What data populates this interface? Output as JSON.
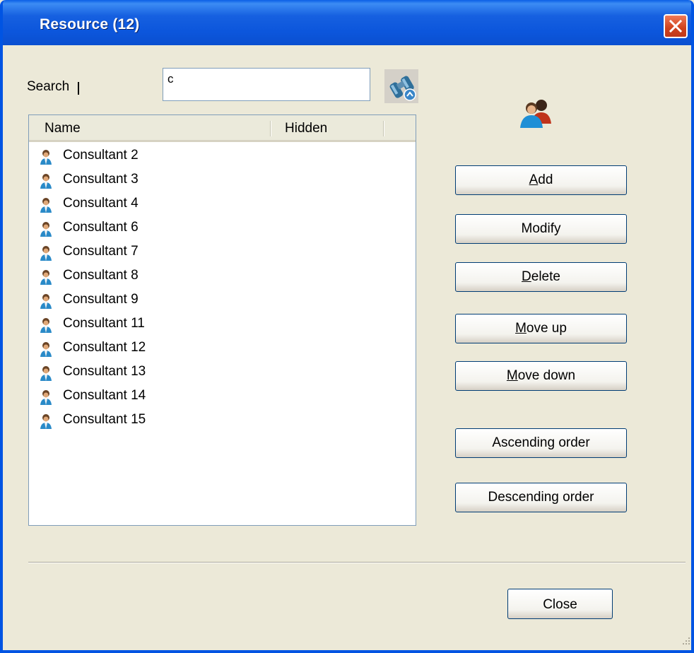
{
  "window": {
    "title": "Resource (12)"
  },
  "search": {
    "label": "Search",
    "value": "c"
  },
  "list": {
    "columns": [
      "Name",
      "Hidden"
    ],
    "rows": [
      {
        "name": "Consultant 2",
        "hidden": ""
      },
      {
        "name": "Consultant 3",
        "hidden": ""
      },
      {
        "name": "Consultant 4",
        "hidden": ""
      },
      {
        "name": "Consultant 6",
        "hidden": ""
      },
      {
        "name": "Consultant 7",
        "hidden": ""
      },
      {
        "name": "Consultant 8",
        "hidden": ""
      },
      {
        "name": "Consultant 9",
        "hidden": ""
      },
      {
        "name": "Consultant 11",
        "hidden": ""
      },
      {
        "name": "Consultant 12",
        "hidden": ""
      },
      {
        "name": "Consultant 13",
        "hidden": ""
      },
      {
        "name": "Consultant 14",
        "hidden": ""
      },
      {
        "name": "Consultant 15",
        "hidden": ""
      }
    ]
  },
  "buttons": {
    "add": {
      "label": "Add",
      "mnemonic": "A"
    },
    "modify": {
      "label": "Modify"
    },
    "delete": {
      "label": "Delete",
      "mnemonic": "D"
    },
    "move_up": {
      "label": "Move up",
      "mnemonic": "M"
    },
    "move_down": {
      "label": "Move down",
      "mnemonic": "M"
    },
    "ascending": {
      "label": "Ascending order"
    },
    "descending": {
      "label": "Descending order"
    },
    "close": {
      "label": "Close"
    }
  },
  "icons": {
    "close": "close-icon",
    "find": "binoculars-icon",
    "users": "users-icon",
    "row": "person-icon"
  },
  "colors": {
    "titlebar": "#0a5fe6",
    "dialog_bg": "#ece9d8",
    "close_button": "#d0421c"
  }
}
